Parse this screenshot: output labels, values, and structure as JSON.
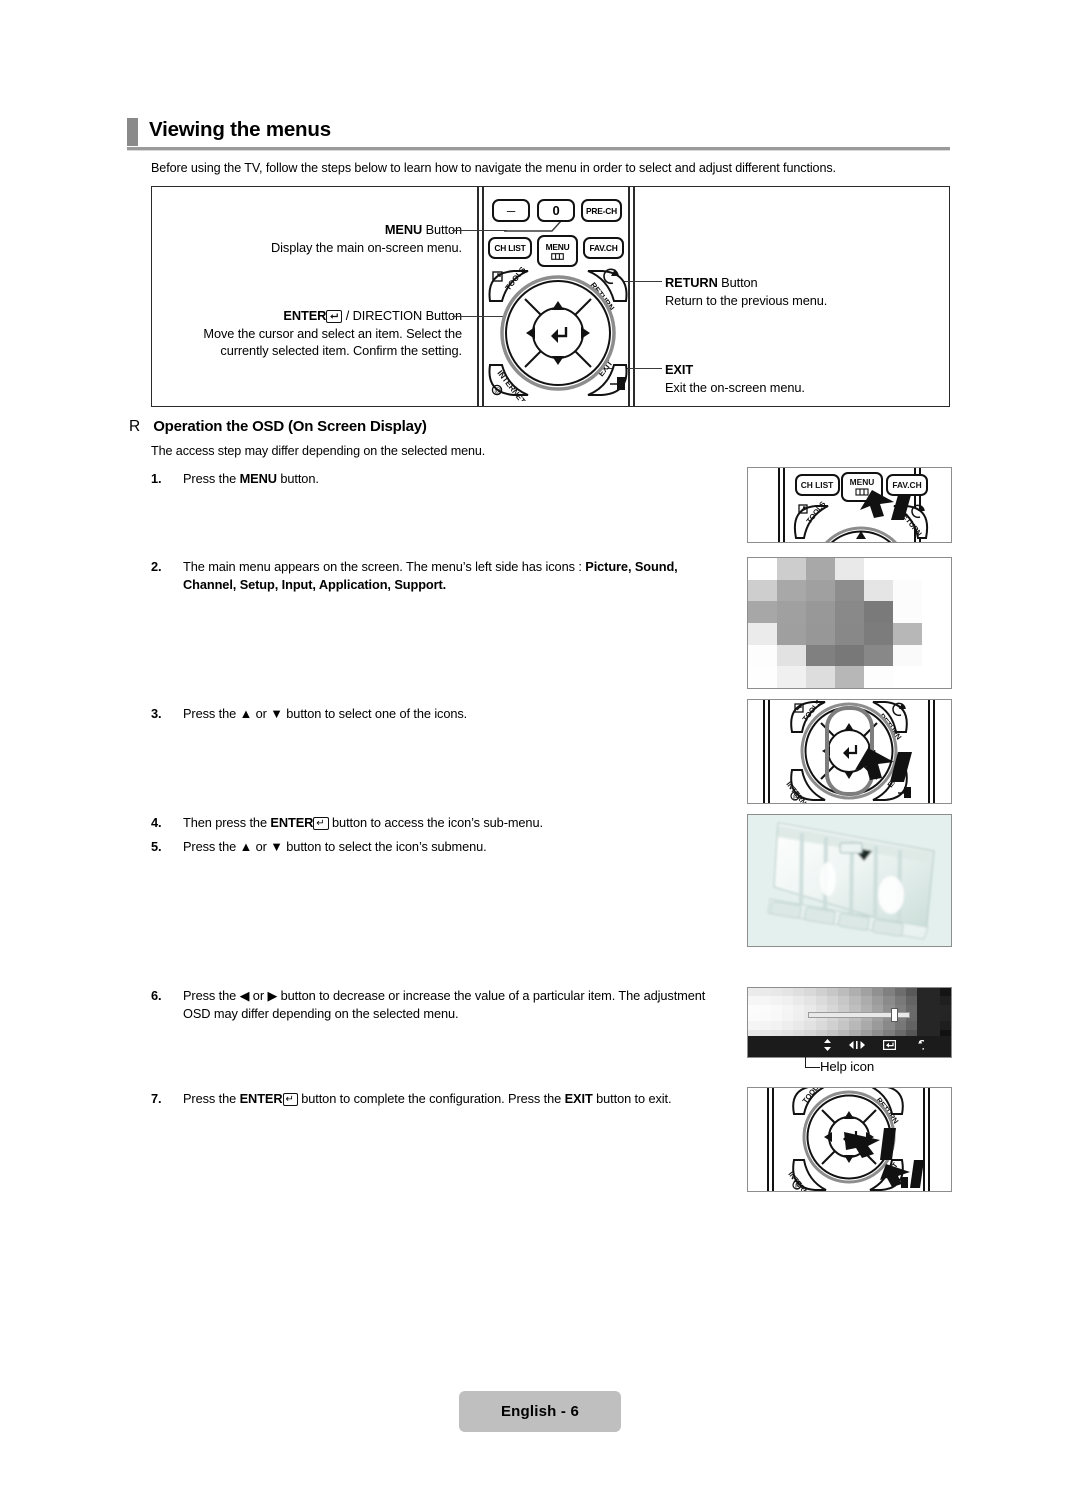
{
  "heading": {
    "title": "Viewing the menus",
    "intro": "Before using the TV, follow the steps below to learn how to navigate the menu in order to select and adjust different functions."
  },
  "remote_panel": {
    "callouts": [
      {
        "name": "menu",
        "title": "MENU",
        "title_suffix": " Button",
        "desc": "Display the main on-screen menu."
      },
      {
        "name": "enter-direction",
        "title": "ENTER",
        "title_suffix": " / DIRECTION Button",
        "desc": "Move the cursor and select an item. Select the currently selected item. Confirm the setting."
      },
      {
        "name": "return",
        "title": "RETURN",
        "title_suffix": " Button",
        "desc": "Return to the previous menu."
      },
      {
        "name": "exit",
        "title": "EXIT",
        "title_suffix": "",
        "desc": "Exit the on-screen menu."
      }
    ],
    "keys": {
      "minus": "—",
      "zero": "0",
      "pre_ch": "PRE-CH",
      "ch_list": "CH LIST",
      "menu": "MENU",
      "fav_ch": "FAV.CH",
      "tools": "TOOLS",
      "return": "RETURN",
      "internet": "INTERNET",
      "exit": "EXIT"
    }
  },
  "osd_section": {
    "bullet_glyph": "R",
    "title": "Operation the OSD (On Screen Display)",
    "note": "The access step may differ depending on the selected menu.",
    "steps": [
      {
        "num": "1.",
        "html": "Press the <b>MENU</b> button."
      },
      {
        "num": "2.",
        "html": "The main menu appears on the screen. The menu’s left side has icons : <b>Picture, Sound, Channel, Setup, Input, Application, Support.</b>"
      },
      {
        "num": "3.",
        "html": "Press the ▲ or ▼ button to select one of the icons."
      },
      {
        "num": "4.",
        "html": "Then press the <b>ENTER</b><span class=\"ebox\">↵</span> button to access the icon’s sub-menu."
      },
      {
        "num": "5.",
        "html": "Press the ▲ or ▼ button to select the icon’s submenu."
      },
      {
        "num": "6.",
        "html": "Press the ◀ or ▶ button to decrease or increase the value of a particular item. The adjustment OSD may differ depending on the selected menu."
      },
      {
        "num": "7.",
        "html": "Press the <b>ENTER</b><span class=\"ebox\">↵</span> button to complete the configuration. Press the <b>EXIT</b> button to exit."
      }
    ]
  },
  "figures": {
    "help_icon_label": "Help icon",
    "help_bar_icons": [
      "updown-arrow-icon",
      "leftright-arrow-icon",
      "enter-icon",
      "return-icon"
    ]
  },
  "footer": {
    "page_label": "English - 6"
  },
  "colors": {
    "heading_bar": "#8a8a8a",
    "rule": "#9a9a9a",
    "badge_bg": "#bfbfbf",
    "ink": "#000000",
    "osd_tint": "#e3f0ec"
  }
}
